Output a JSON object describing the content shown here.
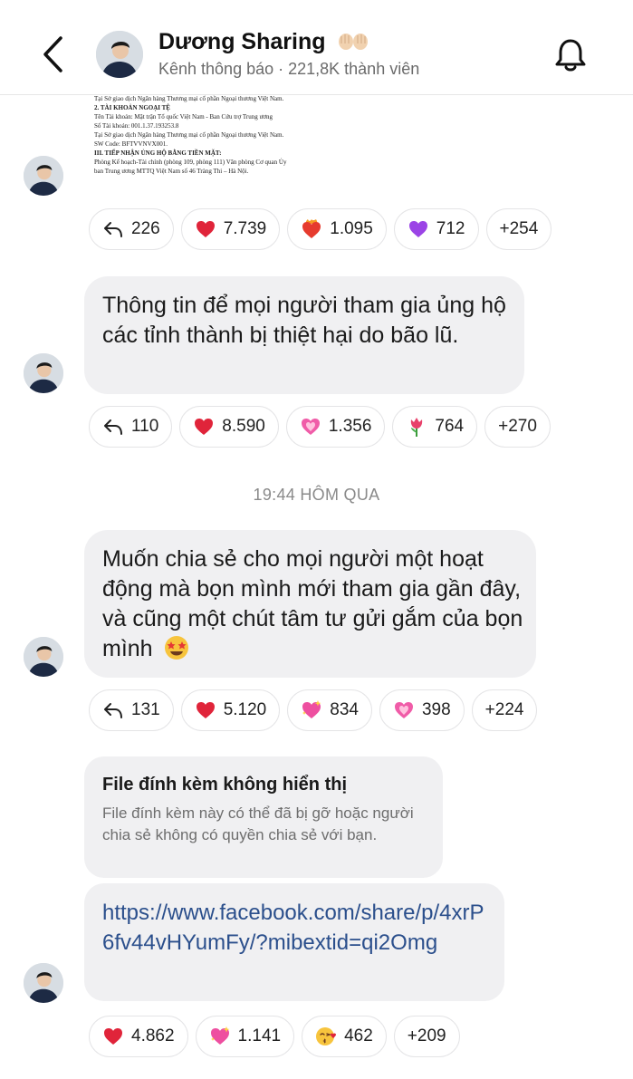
{
  "header": {
    "back_icon": "chevron-left-icon",
    "channel_name": "Dương Sharing",
    "subtitle": "Kênh thông báo · 221,8K thành viên",
    "bell_icon": "bell-icon"
  },
  "doc_image": {
    "lines": [
      "Tại Sở giao dịch Ngân hàng Thương mại cổ phần Ngoại thương Việt Nam.",
      "2. TÀI KHOẢN NGOẠI TỆ",
      "Tên Tài khoản: Mặt trận Tổ quốc Việt Nam - Ban Cứu trợ Trung ương",
      "Số Tài khoản: 001.1.37.193253.8",
      "Tại Sở giao dịch Ngân hàng Thương mại cổ phần Ngoại thương Việt Nam.",
      "SW Code: BFTVVNVX001.",
      "III. TIẾP NHẬN ỦNG HỘ BẰNG TIỀN MẶT:",
      "Phòng Kế hoạch-Tài chính (phòng 109, phòng 111) Văn phòng Cơ quan Ủy",
      "ban Trung ương MTTQ Việt Nam số 46 Tràng Thi – Hà Nội."
    ]
  },
  "messages": [
    {
      "reactions": [
        {
          "icon": "reply-icon",
          "count": "226"
        },
        {
          "icon": "heart-icon",
          "count": "7.739"
        },
        {
          "icon": "heart-on-fire-icon",
          "count": "1.095"
        },
        {
          "icon": "purple-heart-icon",
          "count": "712"
        },
        {
          "icon": "",
          "count": "+254"
        }
      ]
    },
    {
      "text": "Thông tin để mọi người tham gia ủng hộ các tỉnh thành bị thiệt hại do bão lũ.",
      "reactions": [
        {
          "icon": "reply-icon",
          "count": "110"
        },
        {
          "icon": "heart-icon",
          "count": "8.590"
        },
        {
          "icon": "growing-heart-icon",
          "count": "1.356"
        },
        {
          "icon": "tulip-icon",
          "count": "764"
        },
        {
          "icon": "",
          "count": "+270"
        }
      ]
    },
    {
      "text": "Muốn chia sẻ cho mọi người một hoạt động mà bọn mình mới tham gia gần đây, và cũng một chút tâm tư gửi gắm của bọn mình",
      "emoji": "star-struck-icon",
      "reactions": [
        {
          "icon": "reply-icon",
          "count": "131"
        },
        {
          "icon": "heart-icon",
          "count": "5.120"
        },
        {
          "icon": "sparkling-heart-icon",
          "count": "834"
        },
        {
          "icon": "growing-heart-icon",
          "count": "398"
        },
        {
          "icon": "",
          "count": "+224"
        }
      ]
    },
    {
      "file_title": "File đính kèm không hiển thị",
      "file_desc": "File đính kèm này có thể đã bị gỡ hoặc người chia sẻ không có quyền chia sẻ với bạn.",
      "link": "https://www.facebook.com/share/p/4xrP6fv44vHYumFy/?mibextid=qi2Omg",
      "reactions": [
        {
          "icon": "heart-icon",
          "count": "4.862"
        },
        {
          "icon": "sparkling-heart-icon",
          "count": "1.141"
        },
        {
          "icon": "face-blowing-kiss-icon",
          "count": "462"
        },
        {
          "icon": "",
          "count": "+209"
        }
      ]
    }
  ],
  "time_separator": "19:44 HÔM QUA",
  "colors": {
    "bubble": "#f0f0f2",
    "link": "#2b4f8c",
    "heart": "#e0243a"
  }
}
